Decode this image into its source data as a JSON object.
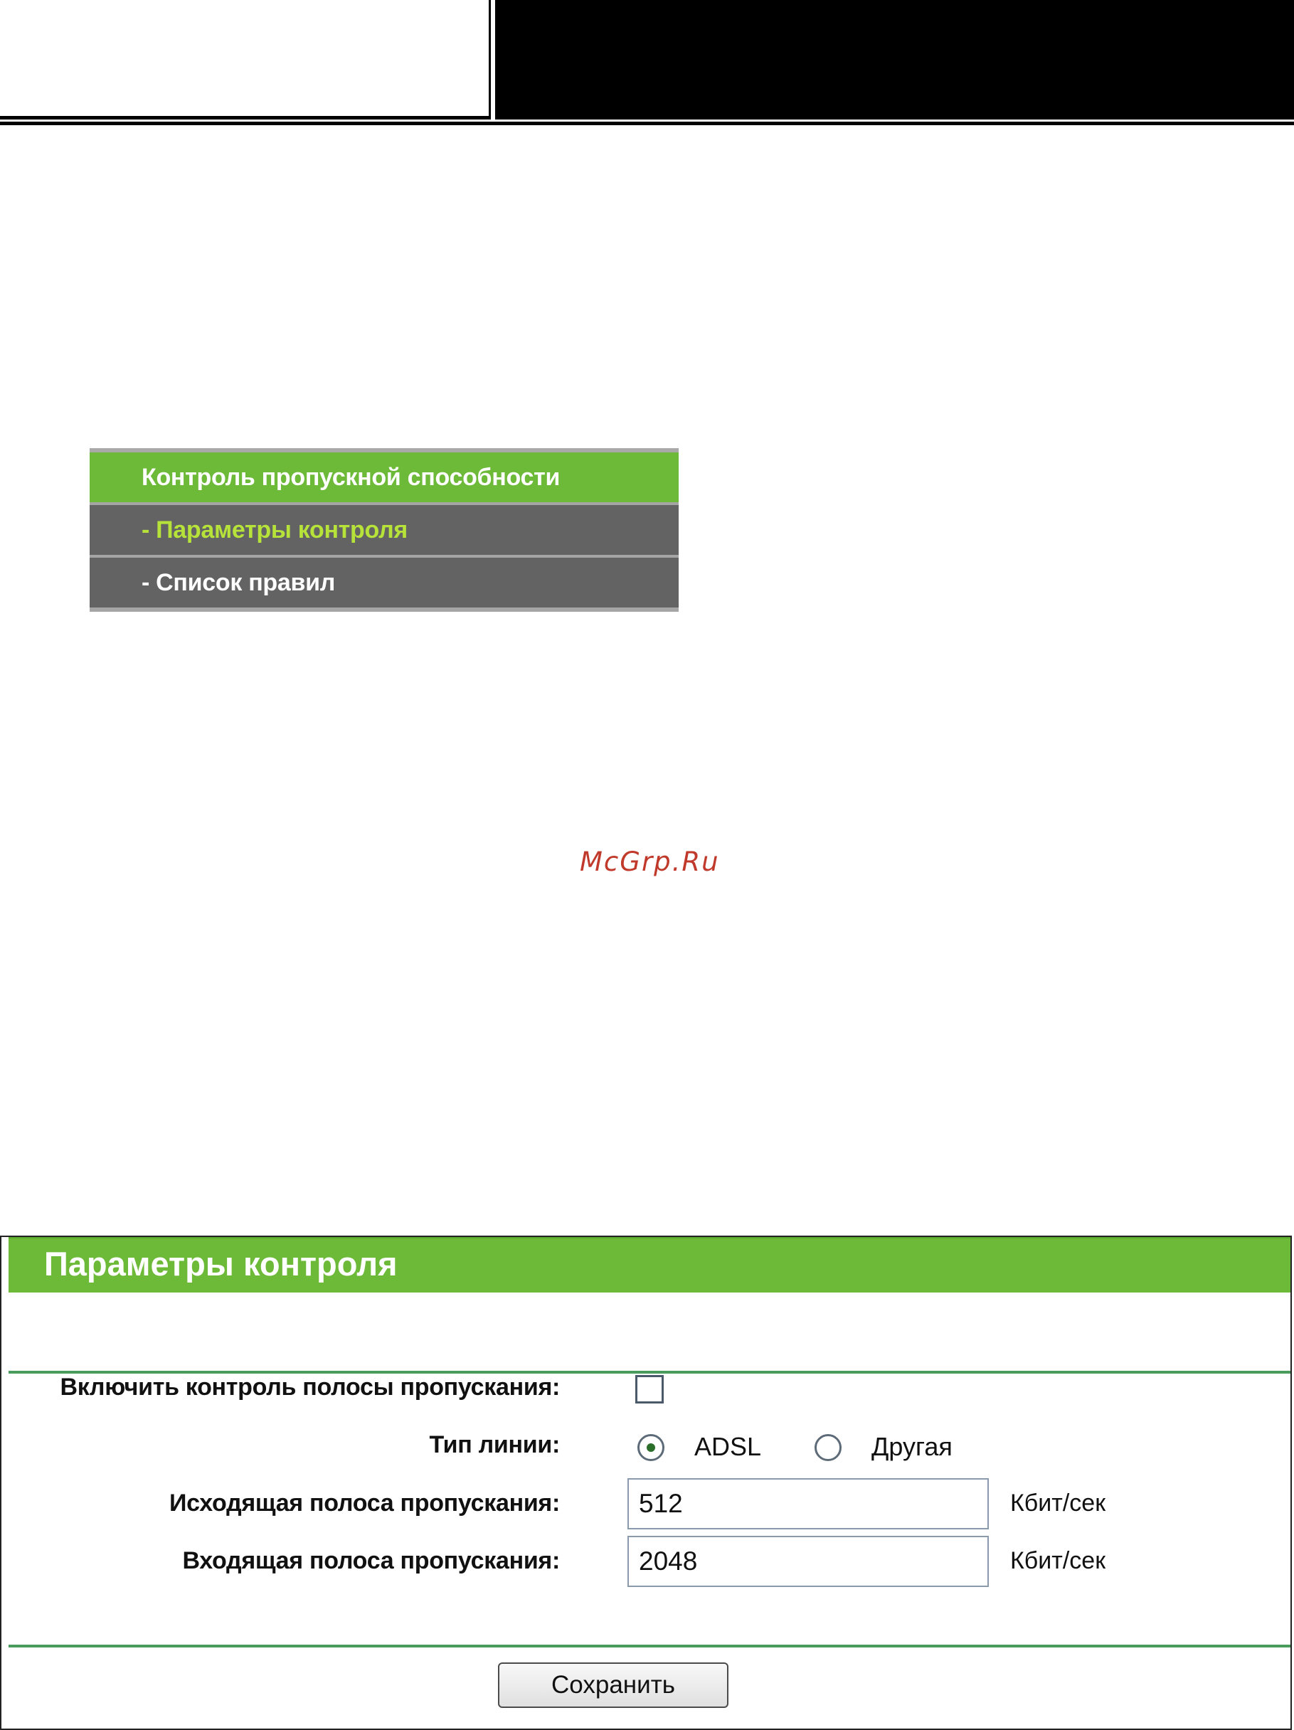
{
  "menu": {
    "title": "Контроль пропускной способности",
    "items": [
      {
        "label": "- Параметры контроля",
        "active": true
      },
      {
        "label": "- Список правил",
        "active": false
      }
    ]
  },
  "watermark": "McGrp.Ru",
  "panel": {
    "title": "Параметры контроля",
    "enable_label": "Включить контроль полосы пропускания:",
    "enable_checked": false,
    "line_type_label": "Тип линии:",
    "line_type_options": [
      {
        "label": "ADSL",
        "selected": true
      },
      {
        "label": "Другая",
        "selected": false
      }
    ],
    "egress_label": "Исходящая полоса пропускания:",
    "egress_value": "512",
    "ingress_label": "Входящая полоса пропускания:",
    "ingress_value": "2048",
    "unit": "Кбит/сек",
    "save_label": "Сохранить"
  },
  "colors": {
    "accent_green": "#6dba38",
    "menu_gray": "#636363",
    "active_item": "#b6e23a",
    "rule_green": "#4a9c5c",
    "watermark": "#c0392b"
  }
}
